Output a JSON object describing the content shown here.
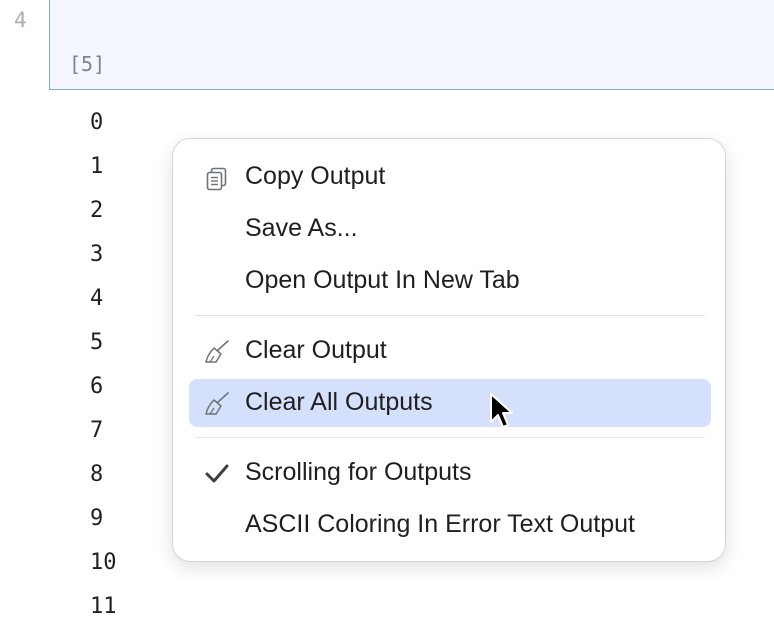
{
  "editor": {
    "line_number": "4",
    "execution_count": "[5]"
  },
  "output": {
    "lines": [
      "0",
      "1",
      "2",
      "3",
      "4",
      "5",
      "6",
      "7",
      "8",
      "9",
      "10",
      "11"
    ]
  },
  "context_menu": {
    "items": [
      {
        "label": "Copy Output",
        "icon": "copy-icon"
      },
      {
        "label": "Save As..."
      },
      {
        "label": "Open Output In New Tab"
      },
      {
        "label": "Clear Output",
        "icon": "broom-icon"
      },
      {
        "label": "Clear All Outputs",
        "icon": "broom-icon",
        "selected": true
      },
      {
        "label": "Scrolling for Outputs",
        "checked": true
      },
      {
        "label": "ASCII Coloring In Error Text Output"
      }
    ],
    "highlight_color": "#d5e1fc"
  }
}
